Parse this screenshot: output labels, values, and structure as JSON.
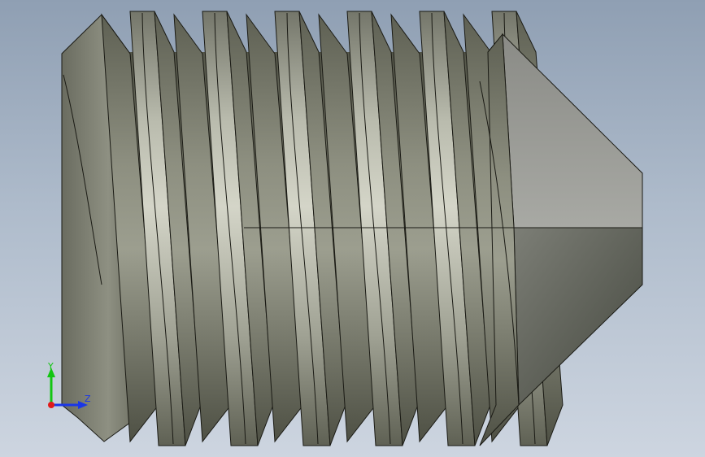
{
  "viewport": {
    "background_top": "#8f9fb3",
    "background_bottom": "#cdd5e0"
  },
  "model": {
    "part": "set-screw-cone-point",
    "thread_count_visible": 6,
    "colors": {
      "thread_light": "#cfd0c3",
      "thread_mid": "#a3a595",
      "thread_dark": "#6d6f60",
      "cone_light": "#a7a8a3",
      "cone_dark": "#4f524b",
      "edge": "#1a1a14"
    }
  },
  "triad": {
    "y_label": "Y",
    "x_label": "Z",
    "y_color": "#12c512",
    "x_color": "#1a36e8",
    "origin_color": "#e01a1a"
  }
}
